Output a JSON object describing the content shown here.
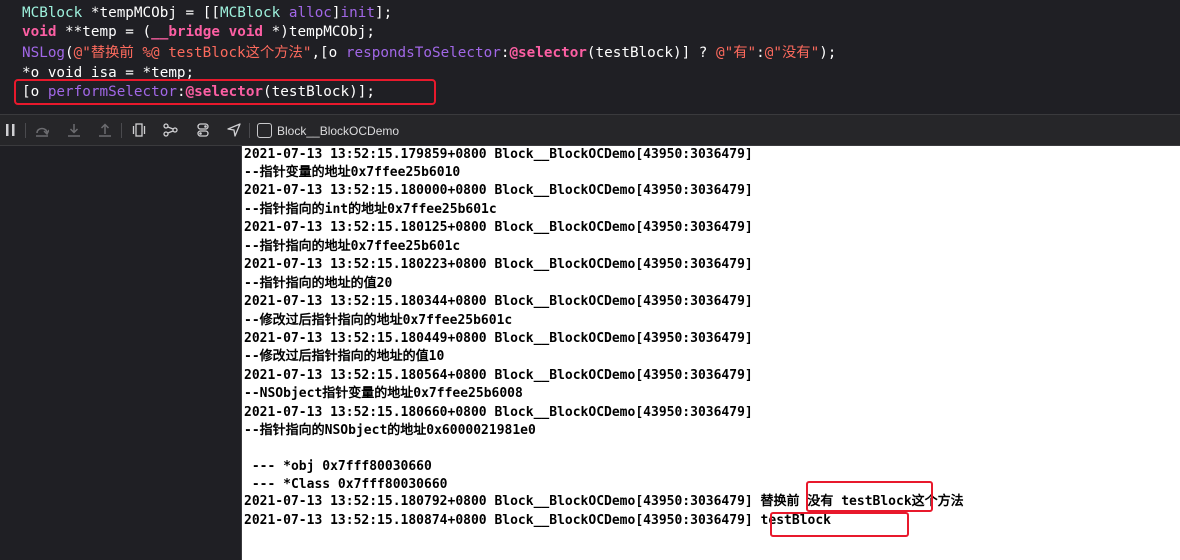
{
  "editor": {
    "line1": {
      "a": "MCBlock",
      "b": " *tempMCObj = [[",
      "c": "MCBlock",
      "d": " ",
      "e": "alloc",
      "f": "]",
      "g": "init",
      "h": "];"
    },
    "line2": {
      "a": "void",
      "b": " **temp = (",
      "c": "__bridge",
      "d": " ",
      "e": "void",
      "f": " *)tempMCObj;"
    },
    "line3": {
      "a": "NSLog",
      "b": "(",
      "c": "@\"替换前 %@ testBlock这个方法\"",
      "d": ",[o ",
      "e": "respondsToSelector",
      "f": ":",
      "g": "@selector",
      "h": "(testBlock)] ? ",
      "i": "@\"有\"",
      "j": ":",
      "k": "@\"没有\"",
      "l": ");"
    },
    "line4": {
      "a": "*o_void_isa = *temp;"
    },
    "line5": {
      "a": "[o ",
      "b": "performSelector",
      "c": ":",
      "d": "@selector",
      "e": "(testBlock)];"
    }
  },
  "debug_bar": {
    "breadcrumb": "Block__BlockOCDemo",
    "icons": [
      "pause-icon",
      "step-over-icon",
      "step-into-icon",
      "step-out-icon",
      "debug-view-hierarchy-icon",
      "memory-graph-icon",
      "environment-overrides-icon",
      "simulate-location-icon",
      "target-icon"
    ]
  },
  "console": {
    "lines": [
      "2021-07-13 13:52:15.179859+0800 Block__BlockOCDemo[43950:3036479]",
      "--指针变量的地址0x7ffee25b6010",
      "2021-07-13 13:52:15.180000+0800 Block__BlockOCDemo[43950:3036479]",
      "--指针指向的int的地址0x7ffee25b601c",
      "2021-07-13 13:52:15.180125+0800 Block__BlockOCDemo[43950:3036479]",
      "--指针指向的地址0x7ffee25b601c",
      "2021-07-13 13:52:15.180223+0800 Block__BlockOCDemo[43950:3036479]",
      "--指针指向的地址的值20",
      "2021-07-13 13:52:15.180344+0800 Block__BlockOCDemo[43950:3036479]",
      "--修改过后指针指向的地址0x7ffee25b601c",
      "2021-07-13 13:52:15.180449+0800 Block__BlockOCDemo[43950:3036479]",
      "--修改过后指针指向的地址的值10",
      "2021-07-13 13:52:15.180564+0800 Block__BlockOCDemo[43950:3036479]",
      "--NSObject指针变量的地址0x7ffee25b6008",
      "2021-07-13 13:52:15.180660+0800 Block__BlockOCDemo[43950:3036479]",
      "--指针指向的NSObject的地址0x6000021981e0",
      "",
      " --- *obj 0x7fff80030660",
      " --- *Class 0x7fff80030660",
      "2021-07-13 13:52:15.180792+0800 Block__BlockOCDemo[43950:3036479] 替换前 没有 testBlock这个方法",
      "2021-07-13 13:52:15.180874+0800 Block__BlockOCDemo[43950:3036479] testBlock"
    ]
  },
  "colors": {
    "editor_bg": "#1f1f24",
    "keyword": "#fc5fa3",
    "project_type": "#9ef1dd",
    "system_method": "#a167e6",
    "string": "#fc6a5d",
    "highlight_box": "#e8192c",
    "console_bg": "#ffffff"
  }
}
